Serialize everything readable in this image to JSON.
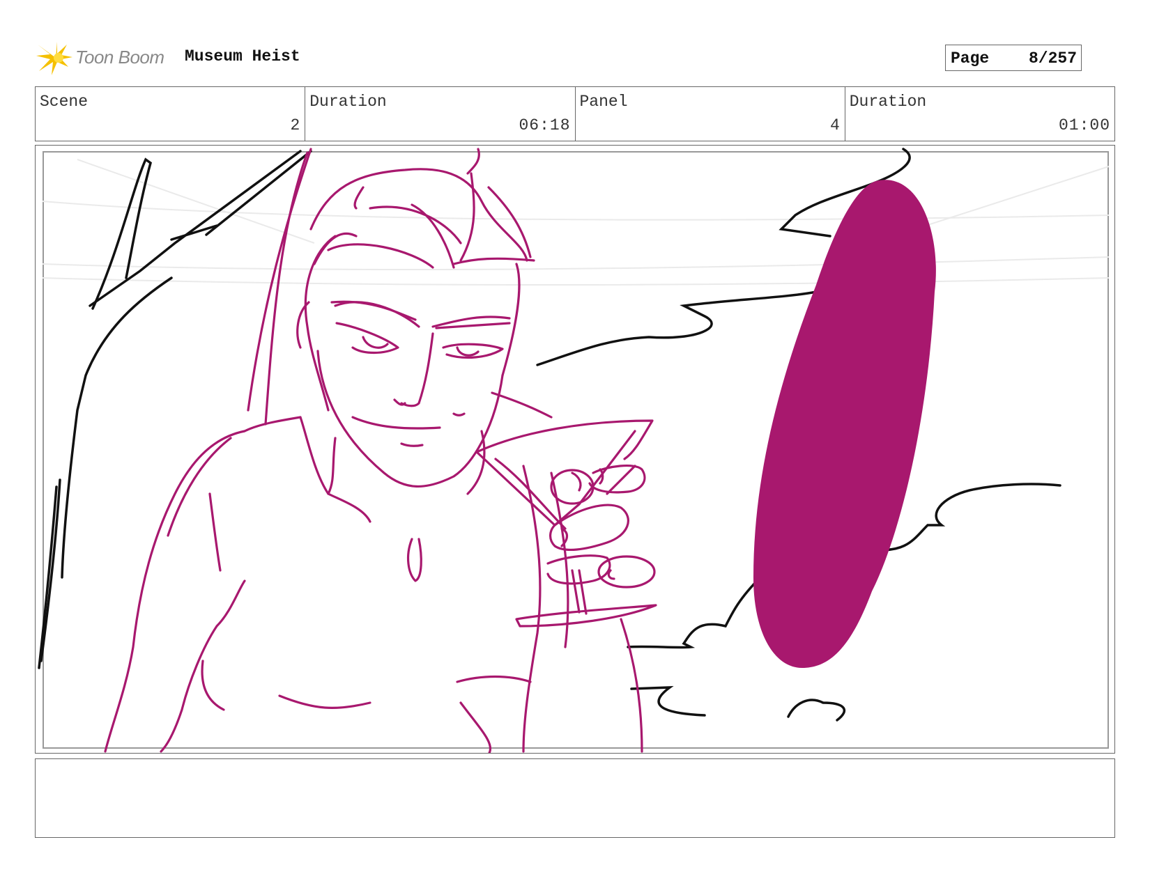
{
  "header": {
    "logo_text": "Toon Boom",
    "project_title": "Museum Heist",
    "page_label": "Page",
    "page_value": "8/257"
  },
  "info": {
    "scene_label": "Scene",
    "scene_value": "2",
    "scene_duration_label": "Duration",
    "scene_duration_value": "06:18",
    "panel_label": "Panel",
    "panel_value": "4",
    "panel_duration_label": "Duration",
    "panel_duration_value": "01:00"
  },
  "colors": {
    "sketch_magenta": "#a8186e",
    "sketch_black": "#111111",
    "border": "#666666",
    "logo_yellow": "#f5c000"
  },
  "icons": {
    "logo": "toon-boom-starburst-icon"
  },
  "notes": {
    "text": ""
  }
}
